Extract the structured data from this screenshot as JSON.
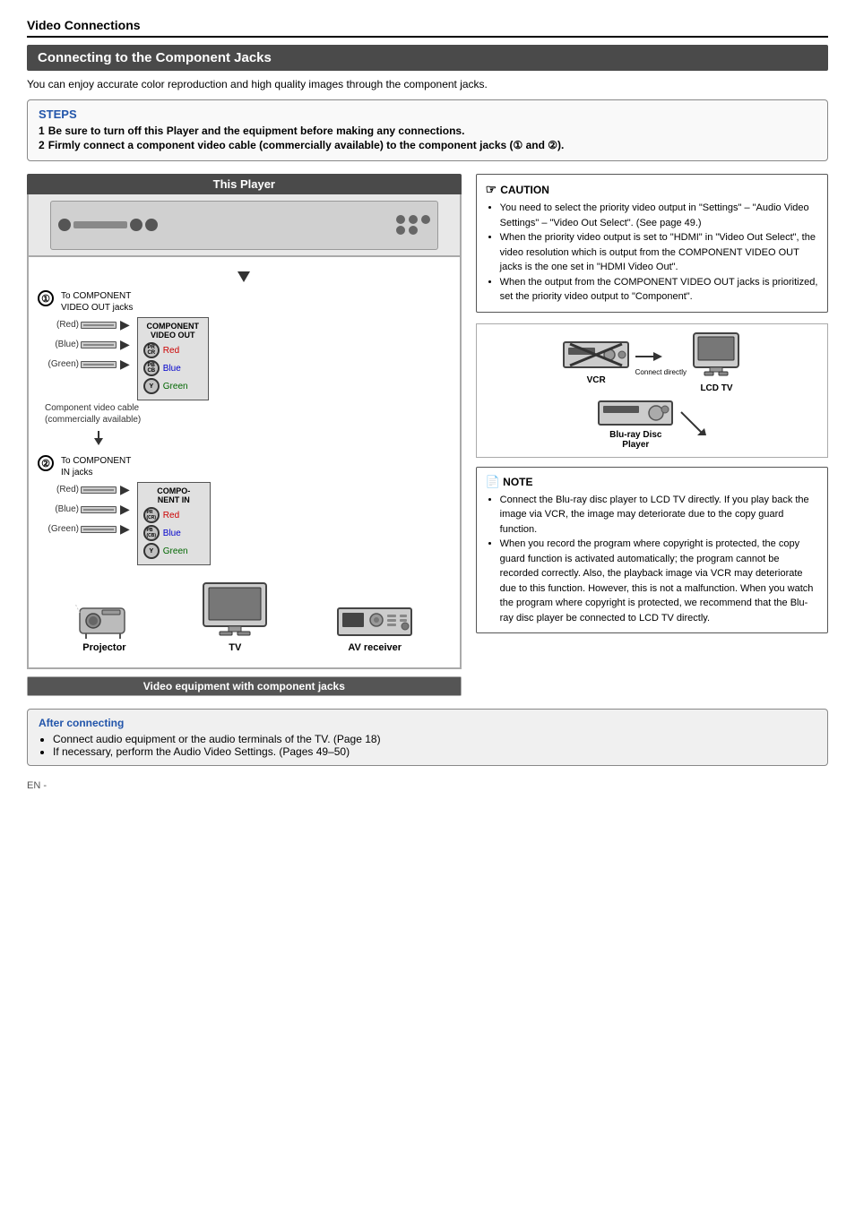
{
  "page": {
    "title": "Video Connections",
    "section_title": "Connecting to the Component Jacks",
    "intro": "You can enjoy accurate color reproduction and high quality images through the component jacks.",
    "steps": {
      "title": "STEPS",
      "items": [
        "Be sure to turn off this Player and the equipment before making any connections.",
        "Firmly connect a component video cable (commercially available) to the component jacks (① and ②)."
      ]
    },
    "this_player_label": "This Player",
    "component_out": {
      "number": "①",
      "to_label": "To COMPONENT\nVIDEO OUT jacks",
      "cable_note": "Component video cable\n(commercially available)",
      "jacks_title": "COMPONENT\nVIDEO OUT",
      "cables": [
        {
          "side_label": "(Red)",
          "color_label": "Red",
          "color_class": "red-text"
        },
        {
          "side_label": "(Blue)",
          "color_label": "Blue",
          "color_class": "blue-text"
        },
        {
          "side_label": "(Green)",
          "color_label": "Green",
          "color_class": "green-text"
        }
      ],
      "jack_labels": [
        {
          "sub": "PR",
          "sub2": "CR",
          "color": "Red",
          "color_class": "red-text"
        },
        {
          "sub": "PB",
          "sub2": "CB",
          "color": "Blue",
          "color_class": "blue-text"
        },
        {
          "sub": "Y",
          "color": "Green",
          "color_class": "green-text"
        }
      ]
    },
    "component_in": {
      "number": "②",
      "to_label": "To COMPONENT\nIN jacks",
      "box_title": "COMPO-\nNENT IN",
      "cables": [
        {
          "side_label": "(Red)",
          "color_label": "Red",
          "color_class": "red-text",
          "jack_sub": "PR",
          "jack_sub2": "(CR)"
        },
        {
          "side_label": "(Blue)",
          "color_label": "Blue",
          "color_class": "blue-text",
          "jack_sub": "PB",
          "jack_sub2": "(CB)"
        },
        {
          "side_label": "(Green)",
          "color_label": "Green",
          "color_class": "green-text",
          "jack_sub": "Y",
          "jack_sub2": ""
        }
      ]
    },
    "video_equip_label": "Video equipment with component jacks",
    "devices": {
      "projector_label": "Projector",
      "tv_label": "TV",
      "av_label": "AV receiver"
    },
    "caution": {
      "title": "CAUTION",
      "items": [
        "You need to select the priority video output in \"Settings\" – \"Audio Video Settings\" – \"Video Out Select\". (See page 49.)",
        "When the priority video output is set to \"HDMI\" in \"Video Out Select\", the video resolution which is output from the COMPONENT VIDEO OUT jacks is the one set in \"HDMI Video Out\".",
        "When the output from the COMPONENT VIDEO OUT jacks is prioritized, set the priority video output to \"Component\"."
      ]
    },
    "vcr_lcd_diagram": {
      "vcr_label": "VCR",
      "bd_label": "Blu-ray Disc\nPlayer",
      "lcd_label": "LCD TV",
      "connect_directly": "Connect directly"
    },
    "note": {
      "title": "NOTE",
      "items": [
        "Connect the Blu-ray disc player to LCD TV directly. If you play back the image via VCR, the image may deteriorate due to the copy guard function.",
        "When you record the program where copyright is protected, the copy guard function is activated automatically; the program cannot be recorded correctly. Also, the playback image via VCR may deteriorate due to this function. However, this is not a malfunction. When you watch the program where copyright is protected, we recommend that the Blu-ray disc player be connected to LCD TV directly."
      ]
    },
    "after_connecting": {
      "title": "After connecting",
      "items": [
        "Connect audio equipment or the audio terminals of the TV. (Page 18)",
        "If necessary, perform the Audio Video Settings. (Pages 49–50)"
      ]
    },
    "footer": "EN -"
  }
}
